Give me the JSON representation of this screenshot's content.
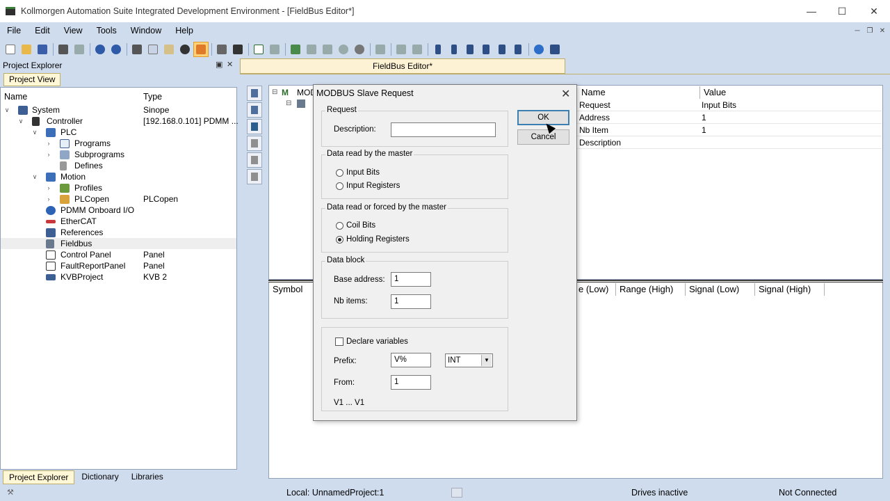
{
  "window": {
    "title": "Kollmorgen Automation Suite Integrated Development Environment - [FieldBus Editor*]"
  },
  "menu": [
    "File",
    "Edit",
    "View",
    "Tools",
    "Window",
    "Help"
  ],
  "project_explorer": {
    "header": "Project Explorer",
    "tab": "Project Explorer",
    "columns": {
      "name": "Name",
      "type": "Type"
    },
    "tree": [
      {
        "label": "System",
        "type": "Sinope"
      },
      {
        "label": "Controller",
        "type": "[192.168.0.101] PDMM ..."
      },
      {
        "label": "PLC",
        "type": ""
      },
      {
        "label": "Programs",
        "type": ""
      },
      {
        "label": "Subprograms",
        "type": ""
      },
      {
        "label": "Defines",
        "type": ""
      },
      {
        "label": "Motion",
        "type": ""
      },
      {
        "label": "Profiles",
        "type": ""
      },
      {
        "label": "PLCopen",
        "type": "PLCopen"
      },
      {
        "label": "PDMM Onboard I/O",
        "type": ""
      },
      {
        "label": "EtherCAT",
        "type": ""
      },
      {
        "label": "References",
        "type": ""
      },
      {
        "label": "Fieldbus",
        "type": ""
      },
      {
        "label": "Control Panel",
        "type": "Panel"
      },
      {
        "label": "FaultReportPanel",
        "type": "Panel"
      },
      {
        "label": "KVBProject",
        "type": "KVB 2"
      }
    ],
    "bottom_tabs": [
      "Project Explorer",
      "Dictionary",
      "Libraries"
    ]
  },
  "editor": {
    "tab_title": "FieldBus Editor*",
    "tree_root": "MOD",
    "properties": {
      "header_name": "Name",
      "header_value": "Value",
      "rows": [
        {
          "name": "Request",
          "value": "Input Bits"
        },
        {
          "name": "Address",
          "value": "1"
        },
        {
          "name": "Nb Item",
          "value": "1"
        },
        {
          "name": "Description",
          "value": ""
        }
      ]
    },
    "variables_headers": [
      "Symbol",
      "e (Low)",
      "Range (High)",
      "Signal (Low)",
      "Signal (High)"
    ]
  },
  "dialog": {
    "title": "MODBUS Slave Request",
    "ok_label": "OK",
    "cancel_label": "Cancel",
    "request": {
      "legend": "Request",
      "description_label": "Description:",
      "description_value": ""
    },
    "read_group": {
      "legend": "Data read by the master",
      "options": [
        "Input Bits",
        "Input Registers"
      ]
    },
    "forced_group": {
      "legend": "Data read or forced by the master",
      "options": [
        "Coil Bits",
        "Holding Registers"
      ],
      "selected": "Holding Registers"
    },
    "data_block": {
      "legend": "Data block",
      "base_address_label": "Base address:",
      "base_address_value": "1",
      "nb_items_label": "Nb items:",
      "nb_items_value": "1"
    },
    "declare": {
      "checkbox_label": "Declare variables",
      "checked": false,
      "prefix_label": "Prefix:",
      "prefix_value": "V%",
      "type_value": "INT",
      "from_label": "From:",
      "from_value": "1",
      "range_text": "V1 ... V1"
    }
  },
  "statusbar": {
    "local": "Local: UnnamedProject:1",
    "drives": "Drives inactive",
    "connection": "Not Connected"
  }
}
